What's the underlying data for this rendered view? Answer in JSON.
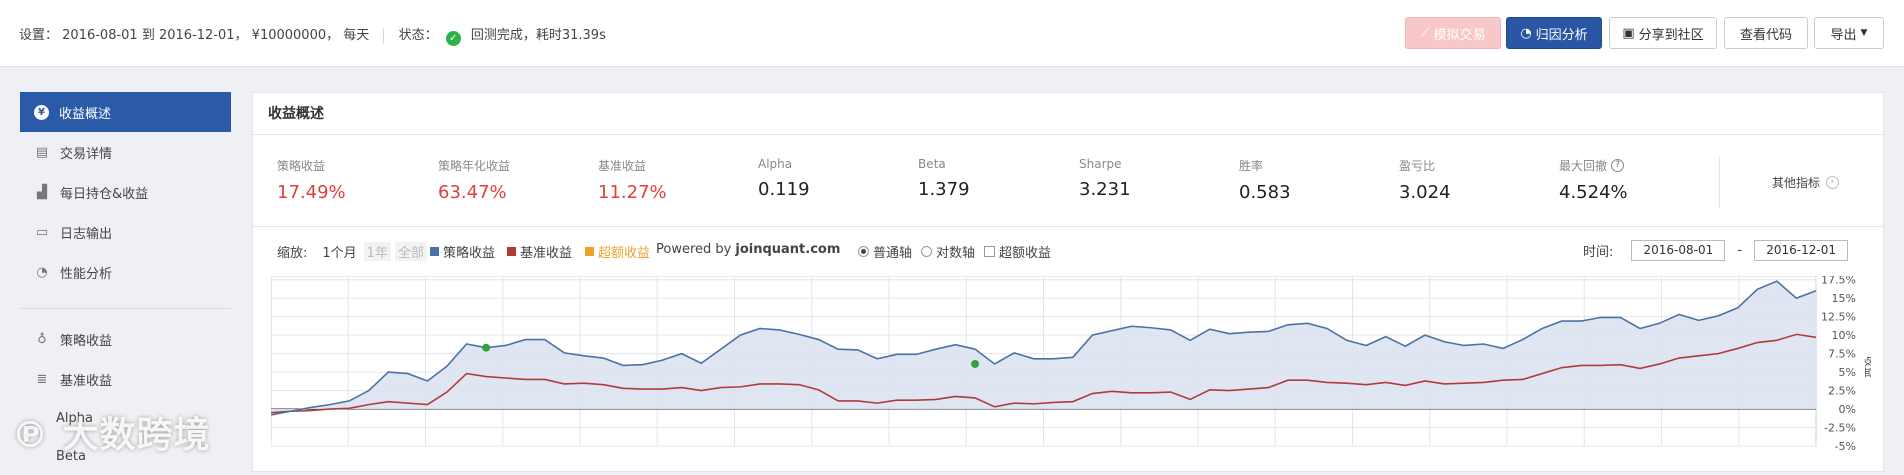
{
  "settings": {
    "prefix": "设置：",
    "period": "2016-08-01 到 2016-12-01，",
    "capital": "¥10000000，",
    "frequency": "每天",
    "status_label": "状态：",
    "status_text": "回测完成，耗时31.39s"
  },
  "toolbar": {
    "sim_trade": "模拟交易",
    "attribution": "归因分析",
    "share": "分享到社区",
    "view_code": "查看代码",
    "export": "导出"
  },
  "sidebar": {
    "items": [
      {
        "label": "收益概述",
        "icon": "yen-icon"
      },
      {
        "label": "交易详情",
        "icon": "list-icon"
      },
      {
        "label": "每日持仓&收益",
        "icon": "bar-chart-icon"
      },
      {
        "label": "日志输出",
        "icon": "log-icon"
      },
      {
        "label": "性能分析",
        "icon": "pie-icon"
      }
    ],
    "sub_items": [
      {
        "label": "策略收益",
        "icon": "bulb-icon"
      },
      {
        "label": "基准收益",
        "icon": "database-icon"
      },
      {
        "label": "Alpha"
      },
      {
        "label": "Beta"
      }
    ]
  },
  "watermark": "大数跨境",
  "panel": {
    "title": "收益概述",
    "metrics": [
      {
        "label": "策略收益",
        "value": "17.49%",
        "color": "#e0403d"
      },
      {
        "label": "策略年化收益",
        "value": "63.47%",
        "color": "#e0403d"
      },
      {
        "label": "基准收益",
        "value": "11.27%",
        "color": "#e0403d"
      },
      {
        "label": "Alpha",
        "value": "0.119"
      },
      {
        "label": "Beta",
        "value": "1.379"
      },
      {
        "label": "Sharpe",
        "value": "3.231"
      },
      {
        "label": "胜率",
        "value": "0.583"
      },
      {
        "label": "盈亏比",
        "value": "3.024"
      },
      {
        "label": "最大回撤",
        "value": "4.524%",
        "icon": "question-icon"
      }
    ],
    "more_metrics": "其他指标"
  },
  "controls": {
    "zoom_label": "缩放:",
    "zoom_1m": "1个月",
    "zoom_1y": "1年",
    "zoom_all": "全部",
    "legend_strategy": "策略收益",
    "legend_benchmark": "基准收益",
    "legend_excess": "超额收益",
    "powered_prefix": "Powered by",
    "powered_brand": "joinquant.com",
    "axis_normal": "普通轴",
    "axis_log": "对数轴",
    "excess_check": "超额收益",
    "time_label": "时间:",
    "date_from": "2016-08-01",
    "date_sep": "-",
    "date_to": "2016-12-01"
  },
  "chart_data": {
    "type": "line",
    "ylim": [
      -5,
      18
    ],
    "y_ticks": [
      "17.5%",
      "15%",
      "12.5%",
      "10%",
      "7.5%",
      "5%",
      "2.5%",
      "0%",
      "-2.5%",
      "-5%"
    ],
    "y_tick_values": [
      17.5,
      15,
      12.5,
      10,
      7.5,
      5,
      2.5,
      0,
      -2.5,
      -5
    ],
    "ylabel": "收益",
    "colors": {
      "strategy": "#4a72a8",
      "benchmark": "#b33a3a",
      "excess": "#f0a030",
      "fill": "#dbe3ef",
      "marker": "#2fa33a"
    },
    "series": [
      {
        "name": "策略收益",
        "values": [
          -0.8,
          -0.3,
          0.2,
          0.6,
          1.1,
          2.5,
          5.0,
          4.8,
          3.8,
          5.8,
          8.8,
          8.3,
          8.6,
          9.4,
          9.4,
          7.6,
          7.2,
          6.9,
          5.9,
          6.0,
          6.6,
          7.5,
          6.2,
          8.1,
          10.0,
          10.9,
          10.7,
          10.1,
          9.4,
          8.1,
          8.0,
          6.8,
          7.4,
          7.4,
          8.1,
          8.7,
          8.1,
          6.1,
          7.6,
          6.8,
          6.8,
          7.0,
          10.0,
          10.6,
          11.2,
          11.0,
          10.7,
          9.3,
          10.8,
          10.2,
          10.4,
          10.5,
          11.4,
          11.6,
          10.9,
          9.3,
          8.6,
          9.8,
          8.5,
          10.0,
          9.1,
          8.6,
          8.8,
          8.2,
          9.4,
          10.9,
          11.9,
          11.9,
          12.4,
          12.4,
          10.9,
          11.6,
          12.8,
          12.0,
          12.6,
          13.7,
          16.2,
          17.3,
          15.0,
          16.0
        ]
      },
      {
        "name": "基准收益",
        "values": [
          -0.5,
          -0.3,
          -0.2,
          0.0,
          0.1,
          0.6,
          1.0,
          0.8,
          0.6,
          2.3,
          4.8,
          4.4,
          4.2,
          4.0,
          4.0,
          3.4,
          3.5,
          3.3,
          2.8,
          2.7,
          2.7,
          2.9,
          2.5,
          2.9,
          3.0,
          3.4,
          3.4,
          3.3,
          2.6,
          1.1,
          1.1,
          0.8,
          1.2,
          1.2,
          1.3,
          1.7,
          1.5,
          0.3,
          0.8,
          0.7,
          0.9,
          1.0,
          2.1,
          2.4,
          2.2,
          2.2,
          2.3,
          1.3,
          2.6,
          2.5,
          2.7,
          2.9,
          3.9,
          3.9,
          3.6,
          3.5,
          3.3,
          3.6,
          3.2,
          3.8,
          3.4,
          3.5,
          3.6,
          3.9,
          4.0,
          4.8,
          5.6,
          5.9,
          5.9,
          6.0,
          5.5,
          6.1,
          6.9,
          7.2,
          7.5,
          8.2,
          9.0,
          9.3,
          10.1,
          9.7
        ]
      }
    ],
    "markers": [
      {
        "index": 11,
        "value": 8.3
      },
      {
        "index": 36,
        "value": 6.1
      }
    ]
  }
}
